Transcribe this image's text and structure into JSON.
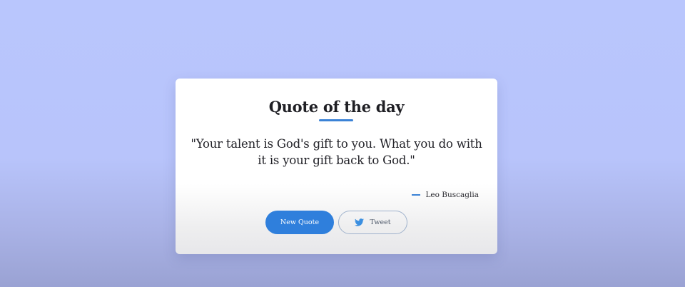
{
  "card": {
    "title": "Quote of the day",
    "quote": "\"Your talent is God's gift to you. What you do with it is your gift back to God.\"",
    "author": "Leo Buscaglia"
  },
  "buttons": {
    "new_quote_label": "New Quote",
    "tweet_label": "Tweet"
  },
  "colors": {
    "accent": "#2f7fdc",
    "background": "#b9c6fd"
  },
  "icons": {
    "tweet": "twitter-icon"
  }
}
